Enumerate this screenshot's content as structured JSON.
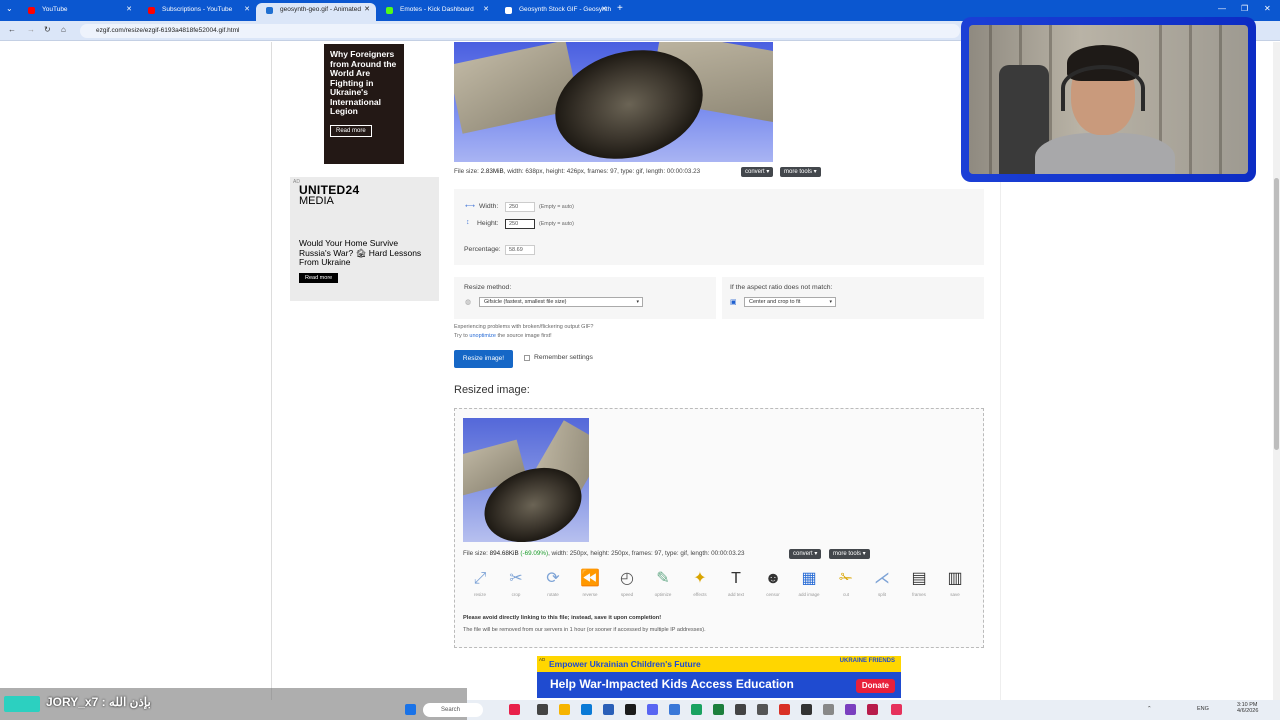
{
  "browser": {
    "tabs": [
      {
        "label": "YouTube",
        "favicon_color": "#ff0000"
      },
      {
        "label": "Subscriptions - YouTube",
        "favicon_color": "#ff0000"
      },
      {
        "label": "geosynth-geo.gif - Animated",
        "favicon_color": "#1f6fd1"
      },
      {
        "label": "Emotes - Kick Dashboard",
        "favicon_color": "#53fc18"
      },
      {
        "label": "Geosynth Stock GIF - Geosynth",
        "favicon_color": "#ffffff"
      }
    ],
    "url": "ezgif.com/resize/ezgif-6193a4818fe52004.gif.html"
  },
  "ads": {
    "left_ad": {
      "headline": "Why Foreigners from Around the World Are Fighting in Ukraine's International Legion",
      "button": "Read more"
    },
    "united24": {
      "tag": "AD",
      "brand_line1": "UNITED24",
      "brand_line2": "MEDIA",
      "headline": "Would Your Home Survive Russia's War? 🏚 Hard Lessons From Ukraine",
      "button": "Read more"
    },
    "banner": {
      "tag": "AD",
      "line1": "Empower Ukrainian Children's Future",
      "line2": "Help War-Impacted Kids Access Education",
      "brand": "UKRAINE FRIENDS",
      "donate": "Donate"
    }
  },
  "source_image": {
    "file_size_label": "File size:",
    "file_size": "2.83MiB",
    "details": ", width: 638px, height: 426px, frames: 97, type: gif, length: 00:00:03.23",
    "convert": "convert ▾",
    "more_tools": "more tools ▾"
  },
  "form": {
    "width_label": "Width:",
    "width_value": "250",
    "width_hint": "(Empty = auto)",
    "height_label": "Height:",
    "height_value": "250",
    "height_hint": "(Empty = auto)",
    "percentage_label": "Percentage:",
    "percentage_value": "58.69",
    "resize_method_label": "Resize method:",
    "resize_method_value": "Gifsicle (fastest, smallest file size)",
    "aspect_label": "If the aspect ratio does not match:",
    "aspect_value": "Center and crop to fit",
    "note_line1": "Experiencing problems with broken/flickering output GIF?",
    "note_line2_pre": "Try to ",
    "note_link": "unoptimize",
    "note_line2_post": " the source image first!",
    "submit": "Resize image!",
    "remember": "Remember settings"
  },
  "result": {
    "heading": "Resized image:",
    "file_size_label": "File size:",
    "file_size": "894.68KiB",
    "reduction": "(-69.09%)",
    "details": ", width: 250px, height: 250px, frames: 97, type: gif, length: 00:00:03.23",
    "convert": "convert ▾",
    "more_tools": "more tools ▾",
    "tools": [
      {
        "label": "resize",
        "icon": "resize-icon"
      },
      {
        "label": "crop",
        "icon": "crop-icon"
      },
      {
        "label": "rotate",
        "icon": "rotate-icon"
      },
      {
        "label": "reverse",
        "icon": "reverse-icon"
      },
      {
        "label": "speed",
        "icon": "speed-icon"
      },
      {
        "label": "optimize",
        "icon": "optimize-icon"
      },
      {
        "label": "effects",
        "icon": "effects-icon"
      },
      {
        "label": "add text",
        "icon": "add-text-icon"
      },
      {
        "label": "censor",
        "icon": "censor-icon"
      },
      {
        "label": "add image",
        "icon": "add-image-icon"
      },
      {
        "label": "cut",
        "icon": "cut-icon"
      },
      {
        "label": "split",
        "icon": "split-icon"
      },
      {
        "label": "frames",
        "icon": "frames-icon"
      },
      {
        "label": "save",
        "icon": "save-icon"
      }
    ],
    "warning": "Please avoid directly linking to this file; instead, save it upon completion!",
    "removal_note": "The file will be removed from our servers in 1 hour (or sooner if accessed by multiple IP addresses)."
  },
  "overlay": {
    "username": "JORY_x7 : بإذن الله"
  },
  "taskbar": {
    "search": "Search",
    "lang": "ENG",
    "time": "3:10 PM",
    "date": "4/6/2026"
  }
}
